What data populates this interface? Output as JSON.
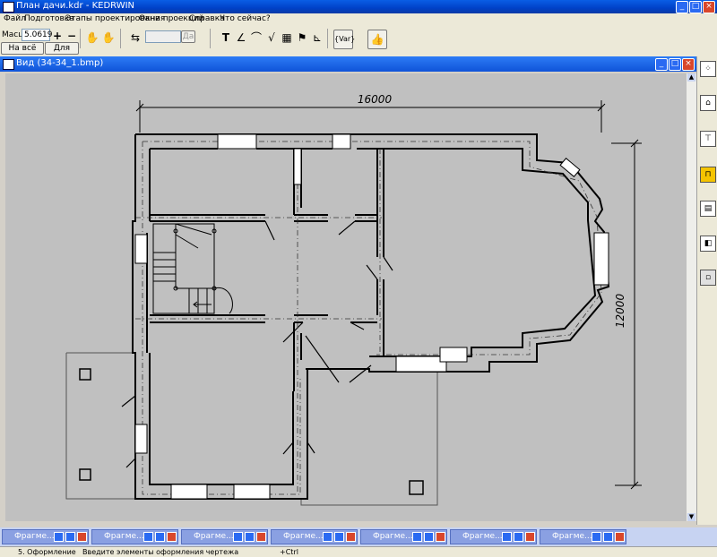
{
  "titlebar": {
    "title": "План дачи.kdr - KEDRWIN",
    "minimize": "_",
    "maximize": "□",
    "close": "×"
  },
  "menu": [
    "Файл",
    "Подготовка",
    "Этапы проектирования",
    "Окна проекций",
    "Справка",
    "Что сейчас?"
  ],
  "toolbar": {
    "scale_label": "Масшт",
    "scale_value": "5.0619",
    "fit_all_button": "На всё окно",
    "for_all_button": "Для всех",
    "zoom_in": "+",
    "zoom_out": "−",
    "disabled_btn": "Да",
    "text_tool": "T"
  },
  "view": {
    "title": "Вид (34-34_1.bmp)",
    "dim_width": "16000",
    "dim_height": "12000",
    "minimize": "_",
    "maximize": "□",
    "close": "×"
  },
  "taskbar": {
    "fragments": [
      "Фрагме...",
      "Фрагме...",
      "Фрагме...",
      "Фрагме...",
      "Фрагме...",
      "Фрагме...",
      "Фрагме..."
    ]
  },
  "status": {
    "stage": "5. Оформление",
    "hint": "Введите элементы оформления чертежа",
    "key": "+Ctrl"
  }
}
